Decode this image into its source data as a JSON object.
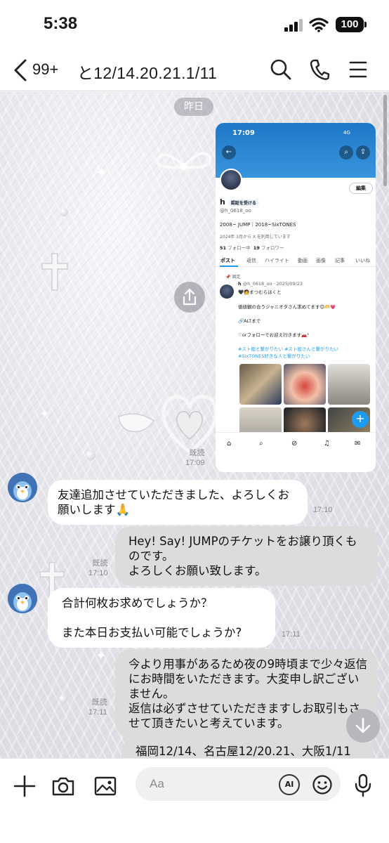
{
  "status_bar": {
    "time": "5:38",
    "battery": "100"
  },
  "header": {
    "unread_count": "99+",
    "title": "と12/14.20.21.1/11"
  },
  "chat": {
    "date_divider": "昨日",
    "image_message": {
      "read_label": "既読",
      "time": "17:09",
      "screenshot": {
        "time": "17:09",
        "network": "4G",
        "edit_label": "編集",
        "name": "h",
        "verify_label": "認証を受ける",
        "handle": "@h_0618_oo",
        "bio": "2008~ JUMP｜2018~SixTONES",
        "joined": "2024年 3月から X を利用しています",
        "following_count": "51",
        "following_label": "フォロー中",
        "followers_count": "19",
        "followers_label": "フォロワー",
        "tabs": [
          "ポスト",
          "返信",
          "ハイライト",
          "動画",
          "画像",
          "記事",
          "いいね"
        ],
        "pinned_label": "固定",
        "post_author": "h",
        "post_handle": "@h_0618_oo · 2025/09/23",
        "post_line1": "🖤🧑まつむらほくと",
        "post_line2": "価値観の合うジャニオタさん求めてます😊🫶💗",
        "post_line3": "🔗ALTまで",
        "post_line4": "♡orフォローでお迎え行きます🚗³",
        "post_hashtags1": "#スト担と繋がりたい #ス卜担さんと繋がりたい",
        "post_hashtags2": "#SixTONES好きな人と繋がりたい"
      }
    },
    "messages": [
      {
        "side": "in",
        "text": "友達追加させていただきました、よろしくお願いします🙏",
        "time": "17:10"
      },
      {
        "side": "out",
        "text": "Hey! Say! JUMPのチケットをお譲り頂くものです。\nよろしくお願い致します。",
        "read_label": "既読",
        "time": "17:10"
      },
      {
        "side": "in",
        "text": "合計何枚お求めでしょうか？\n\nまた本日お支払い可能でしょうか?",
        "time": "17:11"
      },
      {
        "side": "out",
        "text": "今より用事があるため夜の9時頃まで少々返信にお時間をいただきます。大変申し訳ございません。\n返信は必ずさせていただきますしお取引もさせて頂きたいと考えています。",
        "read_label": "既読",
        "time": "17:11"
      },
      {
        "side": "out",
        "text": "福岡12/14、名古屋12/20.21、大阪1/11"
      }
    ]
  },
  "composer": {
    "placeholder": "Aa",
    "ai_label": "AI"
  },
  "colors": {
    "incoming_bubble": "#ffffff",
    "outgoing_bubble": "#dcdcdc",
    "x_blue": "#1d9bf0"
  }
}
